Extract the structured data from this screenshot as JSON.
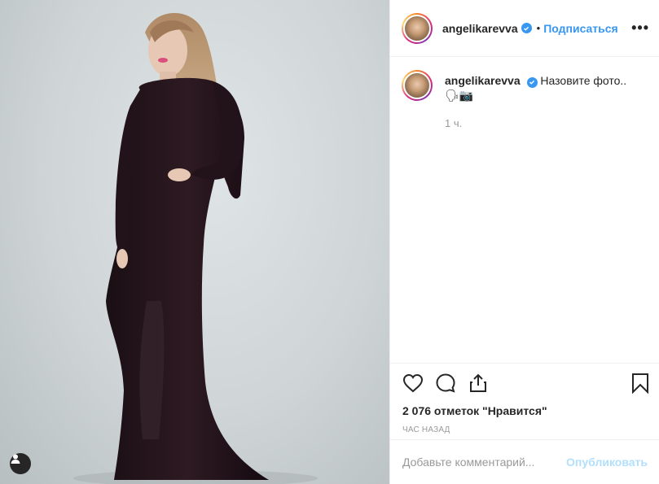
{
  "post": {
    "username": "angelikarevva",
    "follow_label": "Подписаться",
    "separator": "•",
    "more_label": "•••",
    "caption": "Назовите фото.. 🗣📷",
    "caption_time": "1 ч.",
    "likes": "2 076 отметок \"Нравится\"",
    "posted_time": "ЧАС НАЗАД",
    "comment_placeholder": "Добавьте комментарий...",
    "publish_label": "Опубликовать"
  },
  "icons": {
    "verified": "verified-badge-icon",
    "like": "heart-icon",
    "comment": "comment-bubble-icon",
    "share": "share-icon",
    "save": "bookmark-icon",
    "tags": "user-tag-icon"
  },
  "colors": {
    "accent": "#3897f0",
    "publish_disabled": "#b2dffc",
    "muted_text": "#999999",
    "text": "#262626",
    "border": "#efefef"
  }
}
